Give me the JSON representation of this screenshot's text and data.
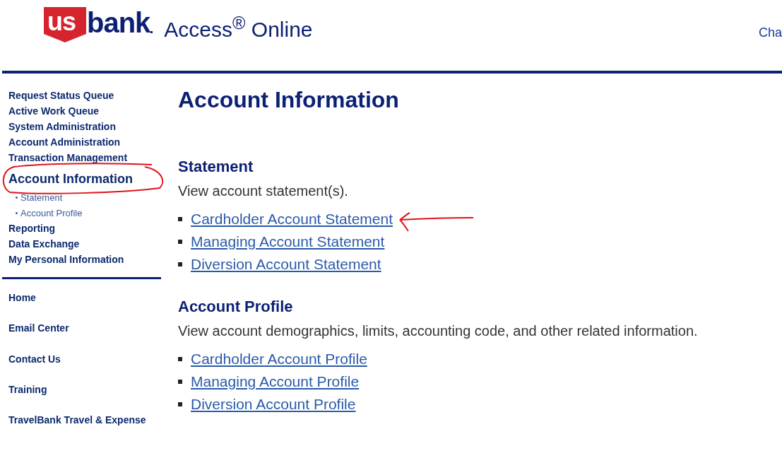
{
  "header": {
    "logo": {
      "shield": "us",
      "word": "bank"
    },
    "product": "Access$^{®}$ Online",
    "user_link": "Cha"
  },
  "sidebar": {
    "items": [
      {
        "label": "Request Status Queue",
        "kind": "main",
        "selected": false,
        "circled": false
      },
      {
        "label": "Active Work Queue",
        "kind": "main",
        "selected": false,
        "circled": false
      },
      {
        "label": "System Administration",
        "kind": "main",
        "selected": false,
        "circled": false
      },
      {
        "label": "Account Administration",
        "kind": "main",
        "selected": false,
        "circled": false
      },
      {
        "label": "Transaction Management",
        "kind": "main",
        "selected": false,
        "circled": false
      },
      {
        "label": "Account Information",
        "kind": "main",
        "selected": true,
        "circled": true
      },
      {
        "label": "Statement",
        "kind": "sub",
        "selected": false,
        "circled": false
      },
      {
        "label": "Account Profile",
        "kind": "sub",
        "selected": false,
        "circled": false
      },
      {
        "label": "Reporting",
        "kind": "main",
        "selected": false,
        "circled": false
      },
      {
        "label": "Data Exchange",
        "kind": "main",
        "selected": false,
        "circled": false
      },
      {
        "label": "My Personal Information",
        "kind": "main",
        "selected": false,
        "circled": false
      }
    ],
    "bottom_links": [
      "Home",
      "Email Center",
      "Contact Us",
      "Training",
      "TravelBank Travel & Expense"
    ]
  },
  "main": {
    "title": "Account Information",
    "sections": [
      {
        "heading": "Statement",
        "description": "View account statement(s).",
        "links": [
          {
            "label": "Cardholder Account Statement",
            "arrow_marked": true
          },
          {
            "label": "Managing Account Statement",
            "arrow_marked": false
          },
          {
            "label": "Diversion Account Statement",
            "arrow_marked": false
          }
        ]
      },
      {
        "heading": "Account Profile",
        "description": "View account demographics, limits, accounting code, and other related information.",
        "links": [
          {
            "label": "Cardholder Account Profile",
            "arrow_marked": false
          },
          {
            "label": "Managing Account Profile",
            "arrow_marked": false
          },
          {
            "label": "Diversion Account Profile",
            "arrow_marked": false
          }
        ]
      }
    ]
  }
}
